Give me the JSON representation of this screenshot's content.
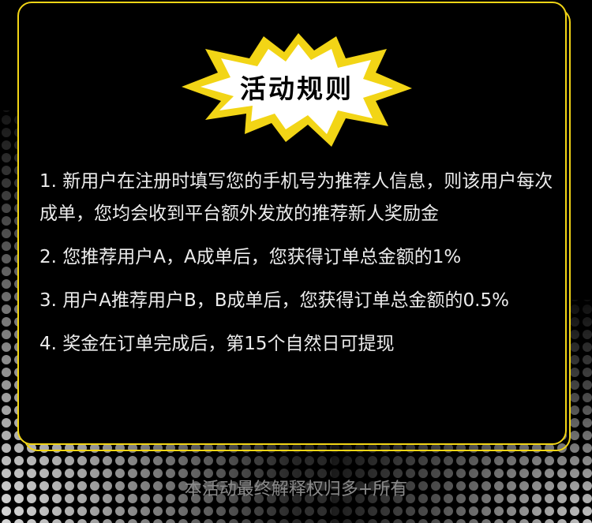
{
  "title": "活动规则",
  "rules": [
    "1. 新用户在注册时填写您的手机号为推荐人信息，则该用户每次成单，您均会收到平台额外发放的推荐新人奖励金",
    "2. 您推荐用户A，A成单后，您获得订单总金额的1%",
    "3. 用户A推荐用户B，B成单后，您获得订单总金额的0.5%",
    "4. 奖金在订单完成后，第15个自然日可提现"
  ],
  "footer": "本活动最终解释权归多+所有",
  "colors": {
    "background": "#000000",
    "border": "#f2d516",
    "burst_fill": "#ffffff",
    "burst_edge": "#f2d516",
    "text": "#ececec",
    "footer_text": "#8a8a8a"
  }
}
